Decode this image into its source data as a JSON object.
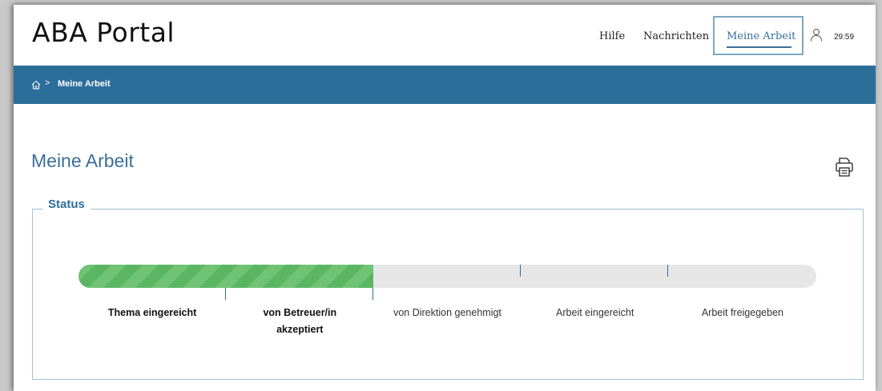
{
  "header": {
    "logo": "ABA Portal",
    "nav": [
      {
        "label": "Hilfe"
      },
      {
        "label": "Nachrichten"
      },
      {
        "label": "Meine Arbeit",
        "active": true
      }
    ],
    "session_timer": "29:59",
    "icons": {
      "user": "user-icon"
    }
  },
  "breadcrumb": {
    "home_icon": "home-icon",
    "separator": ">",
    "current": "Meine Arbeit"
  },
  "main": {
    "title": "Meine Arbeit",
    "print_icon": "printer-icon",
    "status": {
      "legend": "Status",
      "completed_fraction": 0.4,
      "steps": [
        {
          "label": "Thema eingereicht",
          "completed": true
        },
        {
          "label": "von Betreuer/in akzeptiert",
          "completed": true
        },
        {
          "label": "von Direktion genehmigt",
          "completed": false
        },
        {
          "label": "Arbeit eingereicht",
          "completed": false
        },
        {
          "label": "Arbeit freigegeben",
          "completed": false
        }
      ]
    }
  },
  "colors": {
    "brand_blue": "#2b6e9a",
    "progress_green": "#5bb562",
    "track_grey": "#e6e6e6",
    "active_nav_border": "#7fa6c2"
  }
}
